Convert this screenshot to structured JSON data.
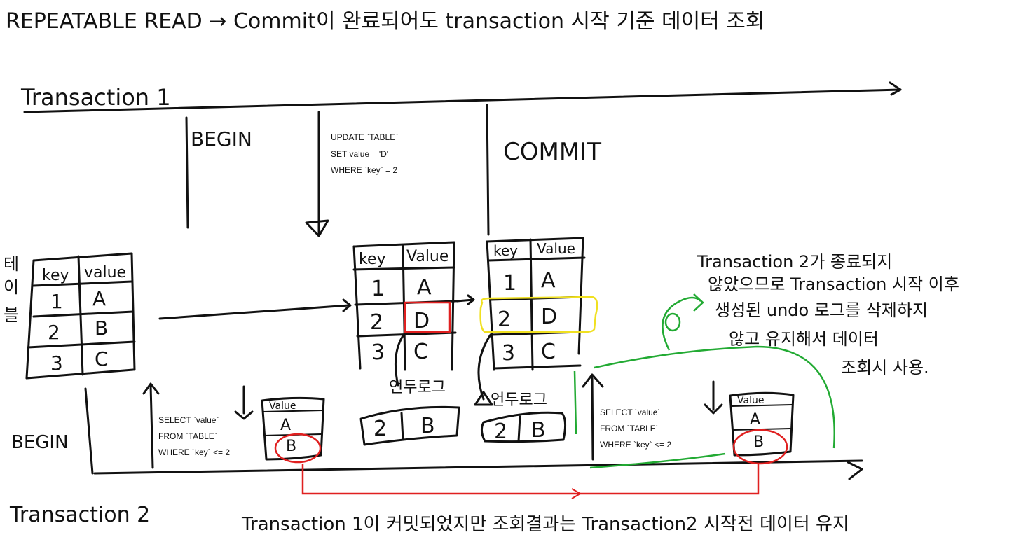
{
  "title": "REPEATABLE READ → Commit이 완료되어도 transaction 시작 기준 데이터 조회",
  "timeline1": {
    "label": "Transaction 1",
    "begin_label": "BEGIN",
    "update_sql": [
      "UPDATE `TABLE`",
      "SET value = 'D'",
      "WHERE `key` = 2"
    ],
    "commit_label": "COMMIT"
  },
  "timeline2": {
    "label": "Transaction 2",
    "begin_label": "BEGIN",
    "select_sql_1": [
      "SELECT `value`",
      "FROM `TABLE`",
      "WHERE `key` <= 2"
    ],
    "select_sql_2": [
      "SELECT `value`",
      "FROM `TABLE`",
      "WHERE `key` <= 2"
    ]
  },
  "table_label": [
    "테",
    "이",
    "블"
  ],
  "table_initial": {
    "headers": [
      "key",
      "value"
    ],
    "rows": [
      [
        "1",
        "A"
      ],
      [
        "2",
        "B"
      ],
      [
        "3",
        "C"
      ]
    ]
  },
  "table_updated": {
    "headers": [
      "key",
      "Value"
    ],
    "rows": [
      [
        "1",
        "A"
      ],
      [
        "2",
        "D"
      ],
      [
        "3",
        "C"
      ]
    ]
  },
  "table_committed": {
    "headers": [
      "key",
      "Value"
    ],
    "rows": [
      [
        "1",
        "A"
      ],
      [
        "2",
        "D"
      ],
      [
        "3",
        "C"
      ]
    ]
  },
  "undo_log_label_1": "언두로그",
  "undo_log_label_2": "언두로그",
  "undo_log_1": [
    "2",
    "B"
  ],
  "undo_log_2": [
    "2",
    "B"
  ],
  "result_1": {
    "header": "Value",
    "rows": [
      "A",
      "B"
    ]
  },
  "result_2": {
    "header": "Value",
    "rows": [
      "A",
      "B"
    ]
  },
  "note": [
    "Transaction 2가 종료되지",
    "않았으므로 Transaction 시작 이후",
    "생성된 undo 로그를 삭제하지",
    "않고 유지해서 데이터",
    "조회시 사용."
  ],
  "bottom_note": "Transaction 1이 커밋되었지만 조회결과는 Transaction2 시작전 데이터 유지",
  "colors": {
    "red": "#e02020",
    "yellow": "#f0e020",
    "green": "#22aa33",
    "ink": "#111111"
  }
}
